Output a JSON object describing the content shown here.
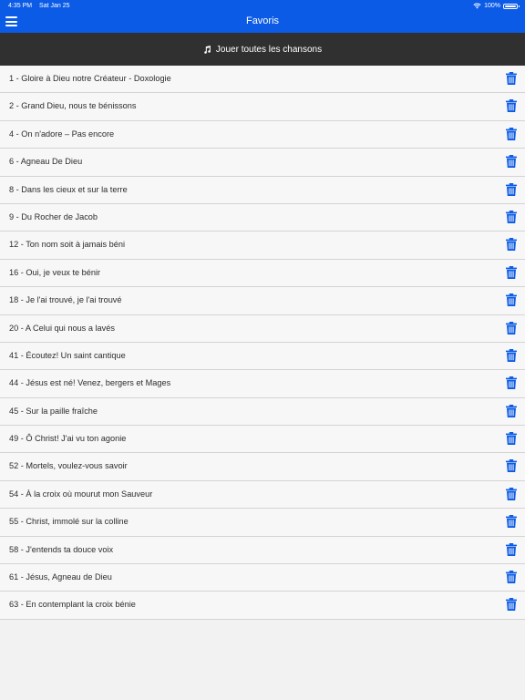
{
  "status_bar": {
    "time": "4:35 PM",
    "date": "Sat Jan 25",
    "battery": "100%"
  },
  "nav": {
    "title": "Favoris",
    "menu_icon": "hamburger-menu-icon"
  },
  "play_all": {
    "label": "Jouer toutes les chansons",
    "icon": "music-note-icon"
  },
  "colors": {
    "nav_blue": "#0b5be6",
    "play_bar": "#303030",
    "trash_blue": "#0b5be6"
  },
  "songs": [
    {
      "title": "1 - Gloire à Dieu notre Créateur - Doxologie"
    },
    {
      "title": "2 - Grand Dieu, nous te bénissons"
    },
    {
      "title": "4 - On n'adore – Pas encore"
    },
    {
      "title": "6 - Agneau De Dieu"
    },
    {
      "title": "8 - Dans les cieux et sur la terre"
    },
    {
      "title": "9 - Du Rocher de Jacob"
    },
    {
      "title": "12 - Ton nom soit à jamais béni"
    },
    {
      "title": "16 - Oui, je veux te bénir"
    },
    {
      "title": "18 - Je l'ai trouvé, je l'ai trouvé"
    },
    {
      "title": "20 - A Celui qui nous a lavés"
    },
    {
      "title": "41 - Écoutez! Un saint cantique"
    },
    {
      "title": "44 - Jésus est né! Venez, bergers et Mages"
    },
    {
      "title": "45 - Sur la paille fraîche"
    },
    {
      "title": "49 - Ô Christ! J'ai vu ton agonie"
    },
    {
      "title": "52 - Mortels, voulez-vous savoir"
    },
    {
      "title": "54 - À la croix où mourut mon Sauveur"
    },
    {
      "title": "55 - Christ, immolé sur la colline"
    },
    {
      "title": "58 - J'entends ta douce voix"
    },
    {
      "title": "61 - Jésus, Agneau de Dieu"
    },
    {
      "title": "63 - En contemplant la croix bénie"
    }
  ]
}
